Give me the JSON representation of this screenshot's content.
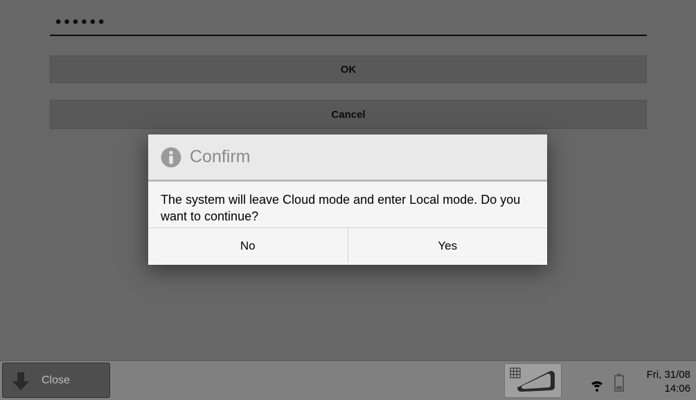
{
  "form": {
    "password_value": "••••••",
    "ok_label": "OK",
    "cancel_label": "Cancel"
  },
  "dialog": {
    "title": "Confirm",
    "message": "The system will leave Cloud mode and enter Local mode. Do you want to continue?",
    "no_label": "No",
    "yes_label": "Yes"
  },
  "bottom": {
    "close_label": "Close",
    "date": "Fri, 31/08",
    "time": "14:06"
  }
}
